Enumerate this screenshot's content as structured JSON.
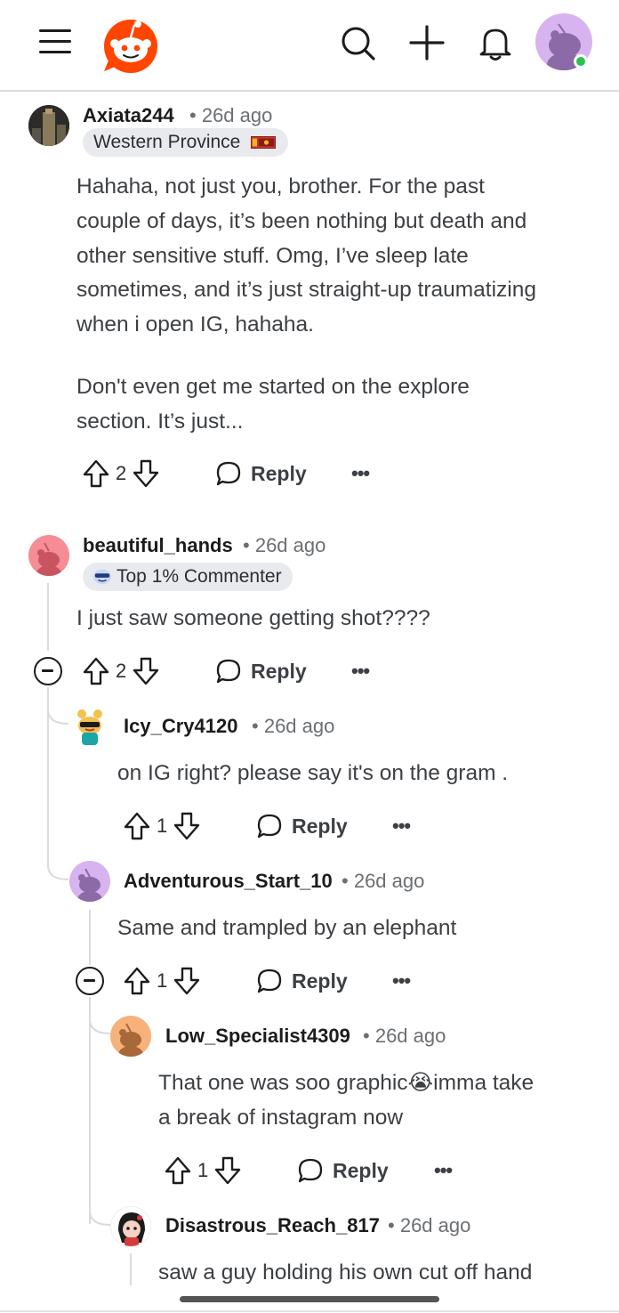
{
  "header": {
    "menu_icon": "hamburger-menu-icon",
    "logo_icon": "reddit-snoo-logo-icon",
    "search_icon": "search-icon",
    "create_icon": "plus-icon",
    "notifications_icon": "bell-icon",
    "avatar_icon": "user-avatar-icon",
    "online_status_color": "#2bc24b"
  },
  "colors": {
    "accent": "#ff4500",
    "text": "#1c1c1c",
    "muted": "#6b6f73",
    "divider": "#d9dcde"
  },
  "comments": [
    {
      "username": "Axiata244",
      "age": "26d ago",
      "flair": "Western Province",
      "body": [
        "Hahaha, not just you, brother. For the past",
        "couple of days, it’s been nothing but death and",
        "other sensitive stuff. Omg, I’ve sleep late",
        "sometimes, and it’s just straight-up traumatizing",
        "when i open IG, hahaha.",
        "",
        "Don't even get me started on the explore",
        "section. It’s just..."
      ],
      "votes": "2",
      "reply_label": "Reply",
      "more_label": "•••"
    },
    {
      "username": "beautiful_hands",
      "age": "26d ago",
      "flair": "Top 1% Commenter",
      "body": [
        "I just saw someone getting shot????"
      ],
      "votes": "2",
      "reply_label": "Reply",
      "more_label": "•••"
    },
    {
      "username": "Icy_Cry4120",
      "age": "26d ago",
      "body": [
        "on IG right? please say it's on the gram ."
      ],
      "votes": "1",
      "reply_label": "Reply",
      "more_label": "•••"
    },
    {
      "username": "Adventurous_Start_10",
      "age": "26d ago",
      "body": [
        "Same and trampled by an elephant"
      ],
      "votes": "1",
      "reply_label": "Reply",
      "more_label": "•••"
    },
    {
      "username": "Low_Specialist4309",
      "age": "26d ago",
      "body": [
        "That one was soo graphic😭imma take",
        "a break of instagram now"
      ],
      "votes": "1",
      "reply_label": "Reply",
      "more_label": "•••"
    },
    {
      "username": "Disastrous_Reach_817",
      "age": "26d ago",
      "body": [
        "saw a guy holding his own cut off hand"
      ]
    }
  ]
}
